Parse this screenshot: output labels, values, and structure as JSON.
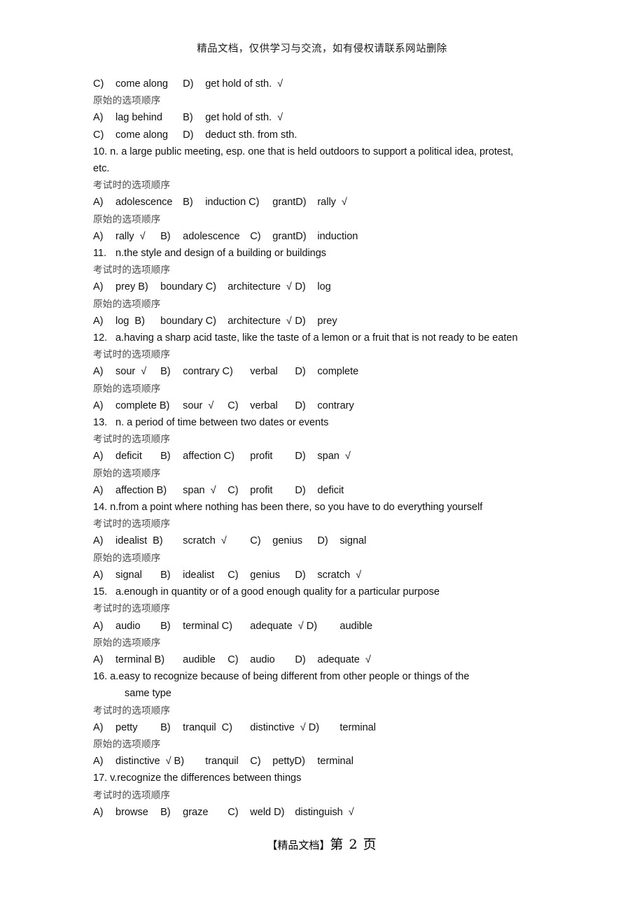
{
  "document": {
    "header_notice": "精品文档，仅供学习与交流，如有侵权请联系网站删除",
    "footer_brand": "【精品文档】",
    "footer_page": "第 2 页",
    "labels": {
      "exam_order": "考试时的选项顺序",
      "original_order": "原始的选项顺序"
    }
  },
  "lines": [
    {
      "kind": "opt",
      "text": "C)\tcome along\tD)\tget hold of sth.  √"
    },
    {
      "kind": "cn",
      "text": "原始的选项顺序"
    },
    {
      "kind": "opt",
      "text": "A)\tlag behind\tB)\tget hold of sth.  √"
    },
    {
      "kind": "opt",
      "text": "C)\tcome along\tD)\tdeduct sth. from sth."
    },
    {
      "kind": "stem",
      "text": "10. n. a large public meeting, esp. one that is held outdoors to support a political idea, protest,"
    },
    {
      "kind": "stem",
      "text": "etc."
    },
    {
      "kind": "cn",
      "text": "考试时的选项顺序"
    },
    {
      "kind": "opt",
      "text": "A)\tadolescence\tB)\tinduction C)\tgrantD)\trally  √"
    },
    {
      "kind": "cn",
      "text": "原始的选项顺序"
    },
    {
      "kind": "opt",
      "text": "A)\trally  √\tB)\tadolescence\tC)\tgrantD)\tinduction"
    },
    {
      "kind": "stem",
      "text": "11.\tn.the style and design of a building or buildings"
    },
    {
      "kind": "cn",
      "text": "考试时的选项顺序"
    },
    {
      "kind": "opt",
      "text": "A)\tprey B)\tboundary C)\tarchitecture  √\tD)\tlog"
    },
    {
      "kind": "cn",
      "text": "原始的选项顺序"
    },
    {
      "kind": "opt",
      "text": "A)\tlog  B)\tboundary C)\tarchitecture  √\tD)\tprey"
    },
    {
      "kind": "stem",
      "text": "12.\ta.having a sharp acid taste, like the taste of a lemon or a fruit that is not ready to be eaten"
    },
    {
      "kind": "cn",
      "text": "考试时的选项顺序"
    },
    {
      "kind": "opt",
      "text": "A)\tsour  √\tB)\tcontrary C)\tverbal\tD)\tcomplete"
    },
    {
      "kind": "cn",
      "text": "原始的选项顺序"
    },
    {
      "kind": "opt",
      "text": "A)\tcomplete B)\tsour  √\tC)\tverbal\tD)\tcontrary"
    },
    {
      "kind": "stem",
      "text": "13.\tn. a period of time between two dates or events"
    },
    {
      "kind": "cn",
      "text": "考试时的选项顺序"
    },
    {
      "kind": "opt",
      "text": "A)\tdeficit\tB)\taffection C)\tprofit\tD)\tspan  √"
    },
    {
      "kind": "cn",
      "text": "原始的选项顺序"
    },
    {
      "kind": "opt",
      "text": "A)\taffection B)\tspan  √\tC)\tprofit\tD)\tdeficit"
    },
    {
      "kind": "stem",
      "text": "14. n.from a point where nothing has been there, so you have to do everything yourself"
    },
    {
      "kind": "cn",
      "text": "考试时的选项顺序"
    },
    {
      "kind": "opt",
      "text": "A)\tidealist  B)\tscratch  √\tC)\tgenius\tD)\tsignal"
    },
    {
      "kind": "cn",
      "text": "原始的选项顺序"
    },
    {
      "kind": "opt",
      "text": "A)\tsignal\tB)\tidealist\tC)\tgenius\tD)\tscratch  √"
    },
    {
      "kind": "stem",
      "text": "15.\ta.enough in quantity or of a good enough quality for a particular purpose"
    },
    {
      "kind": "cn",
      "text": "考试时的选项顺序"
    },
    {
      "kind": "opt",
      "text": "A)\taudio\tB)\tterminal C)\tadequate  √ D)\taudible"
    },
    {
      "kind": "cn",
      "text": "原始的选项顺序"
    },
    {
      "kind": "opt",
      "text": "A)\tterminal B)\taudible\tC)\taudio\tD)\tadequate  √"
    },
    {
      "kind": "stem",
      "text": "16. a.easy to recognize because of being different from other people or things of the"
    },
    {
      "kind": "cont",
      "text": "same type"
    },
    {
      "kind": "cn",
      "text": "考试时的选项顺序"
    },
    {
      "kind": "opt",
      "text": "A)\tpetty\tB)\ttranquil  C)\tdistinctive  √ D)\tterminal"
    },
    {
      "kind": "cn",
      "text": "原始的选项顺序"
    },
    {
      "kind": "opt",
      "text": "A)\tdistinctive  √ B)\ttranquil\tC)\tpettyD)\tterminal"
    },
    {
      "kind": "stem",
      "text": "17. v.recognize the differences between things"
    },
    {
      "kind": "cn",
      "text": "考试时的选项顺序"
    },
    {
      "kind": "opt",
      "text": "A)\tbrowse\tB)\tgraze\tC)\tweld D)\tdistinguish  √"
    }
  ]
}
